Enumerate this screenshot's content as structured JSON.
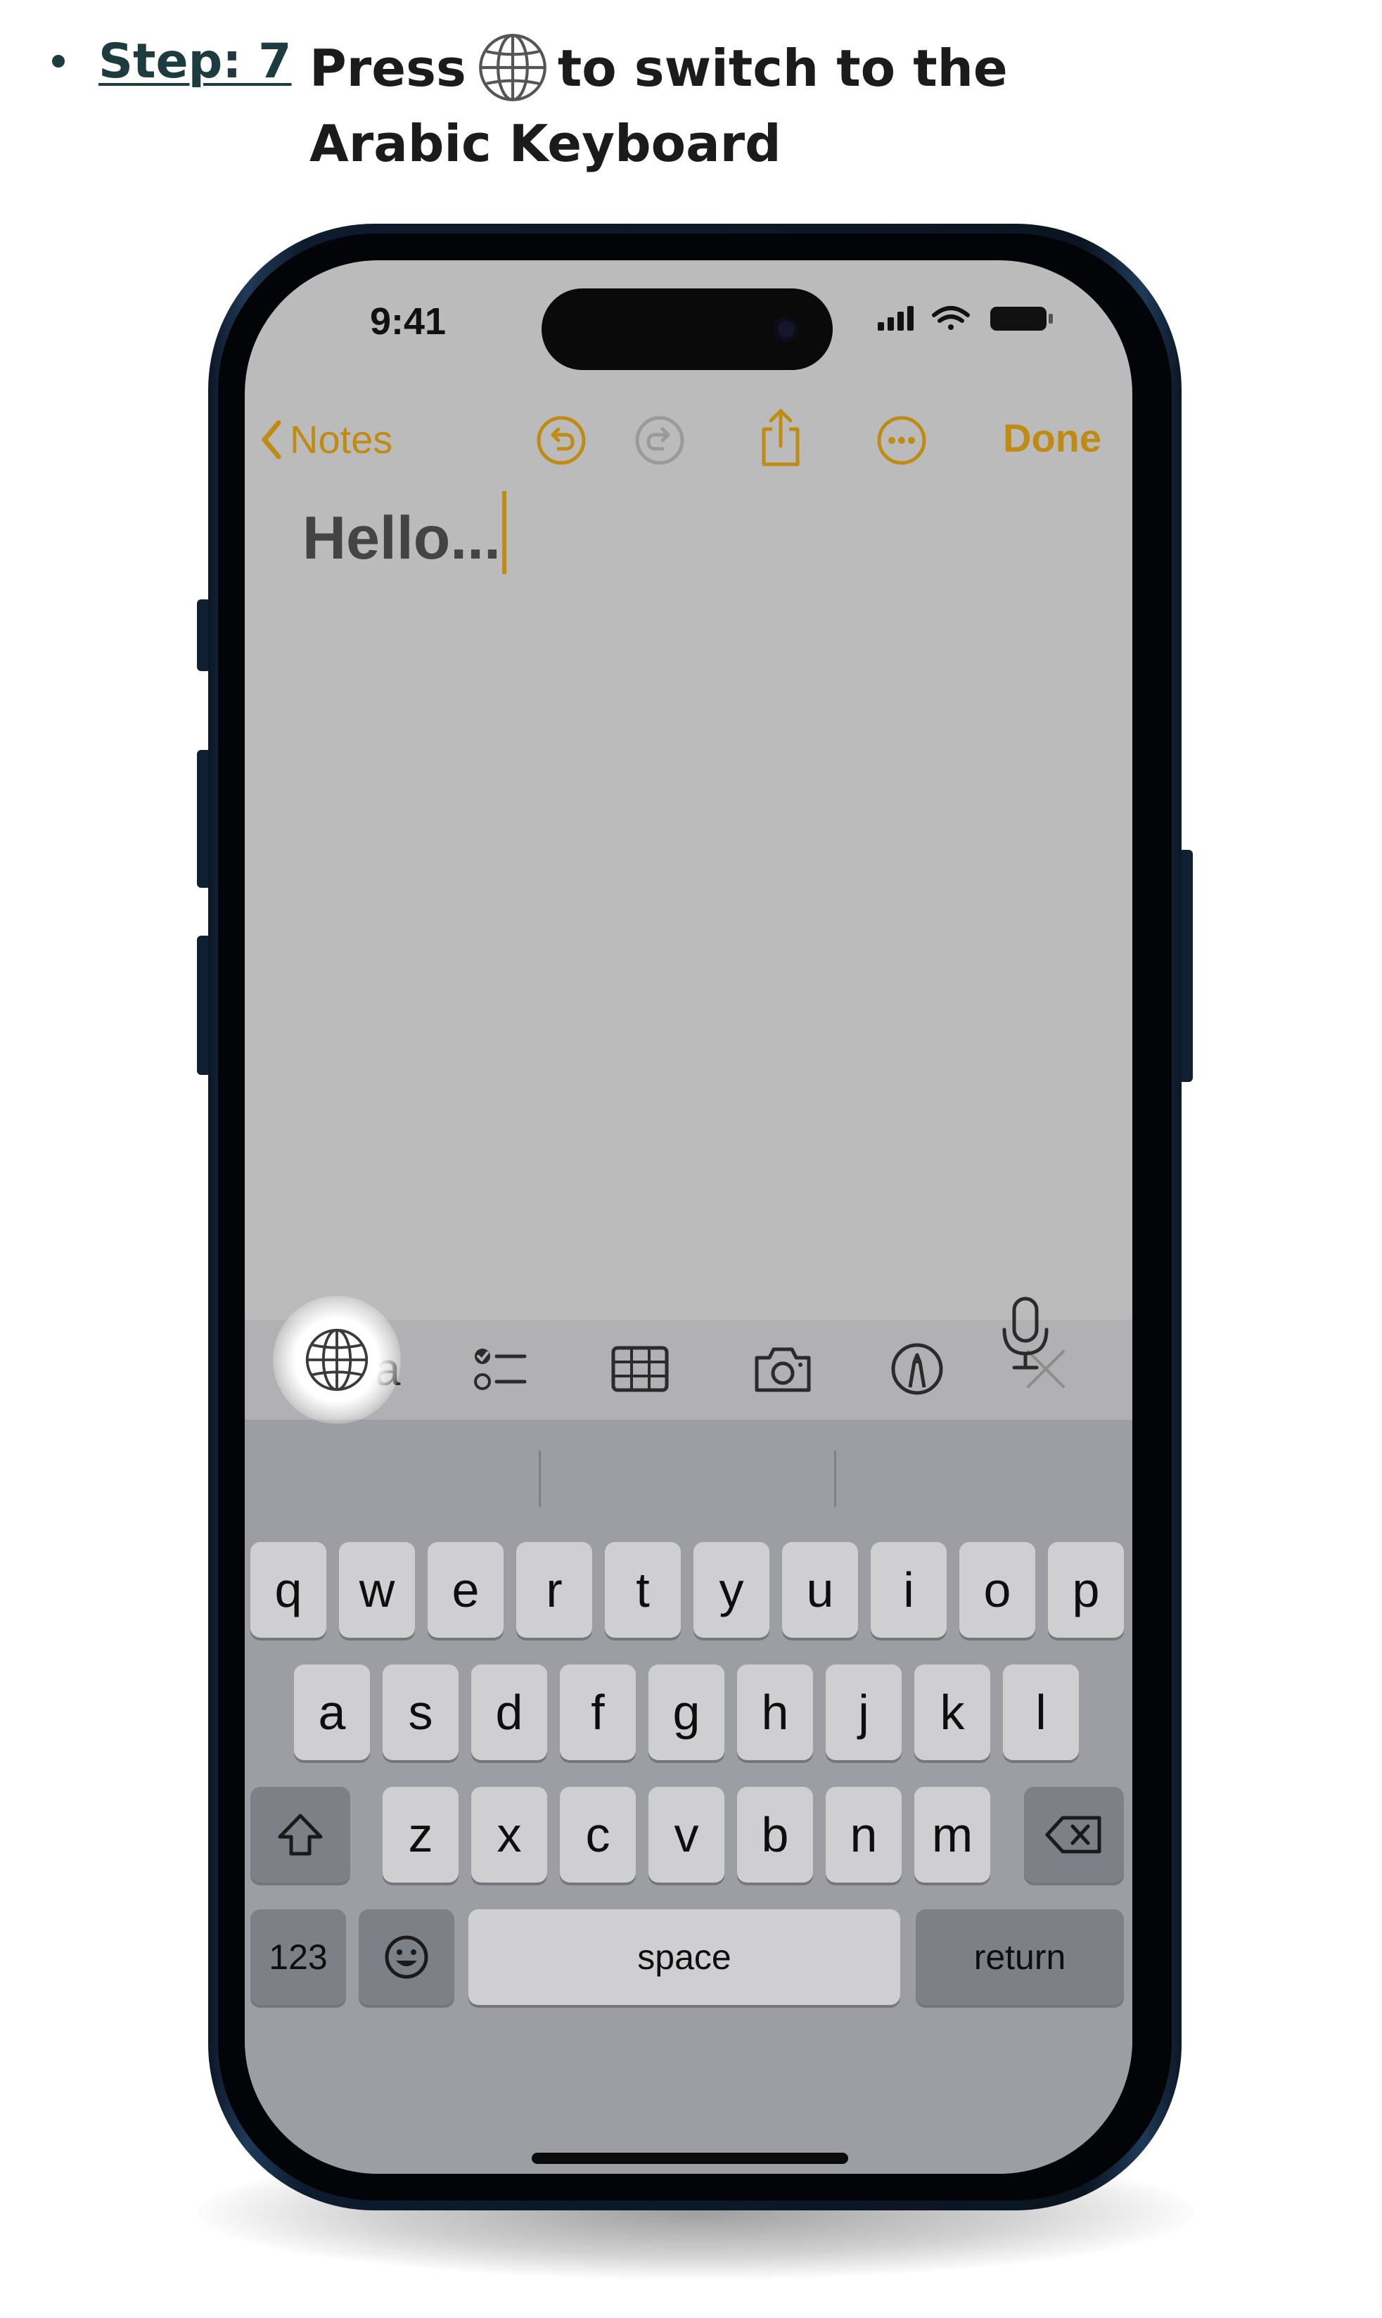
{
  "step": {
    "label": "Step: 7",
    "line1_before": "Press",
    "line1_after": "to switch to the",
    "line2": "Arabic Keyboard",
    "icon": "globe-icon"
  },
  "status_bar": {
    "time": "9:41"
  },
  "notes_toolbar": {
    "back_label": "Notes",
    "done_label": "Done",
    "accent_color": "#c08b12"
  },
  "note": {
    "title": "Hello..."
  },
  "format_bar": {
    "text_style_label": "Aa"
  },
  "keyboard": {
    "row1": [
      "q",
      "w",
      "e",
      "r",
      "t",
      "y",
      "u",
      "i",
      "o",
      "p"
    ],
    "row2": [
      "a",
      "s",
      "d",
      "f",
      "g",
      "h",
      "j",
      "k",
      "l"
    ],
    "row3": [
      "z",
      "x",
      "c",
      "v",
      "b",
      "n",
      "m"
    ],
    "numbers_label": "123",
    "space_label": "space",
    "return_label": "return"
  }
}
